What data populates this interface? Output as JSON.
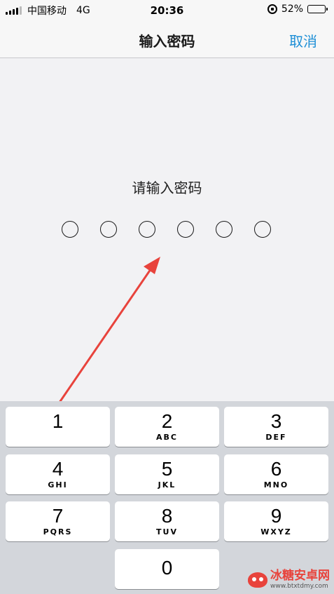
{
  "status_bar": {
    "carrier": "中国移动",
    "network": "4G",
    "time": "20:36",
    "battery": "52%",
    "battery_level": 0.52
  },
  "nav": {
    "title": "输入密码",
    "cancel_label": "取消"
  },
  "prompt": "请输入密码",
  "passcode_length": 6,
  "keypad": [
    {
      "digit": "1",
      "letters": ""
    },
    {
      "digit": "2",
      "letters": "ABC"
    },
    {
      "digit": "3",
      "letters": "DEF"
    },
    {
      "digit": "4",
      "letters": "GHI"
    },
    {
      "digit": "5",
      "letters": "JKL"
    },
    {
      "digit": "6",
      "letters": "MNO"
    },
    {
      "digit": "7",
      "letters": "PQRS"
    },
    {
      "digit": "8",
      "letters": "TUV"
    },
    {
      "digit": "9",
      "letters": "WXYZ"
    },
    {
      "digit": "0",
      "letters": ""
    }
  ],
  "watermark": {
    "name": "冰糖安卓网",
    "url": "www.btxtdmy.com"
  },
  "colors": {
    "accent": "#1e8fd6",
    "annotation_arrow": "#e8433c"
  }
}
